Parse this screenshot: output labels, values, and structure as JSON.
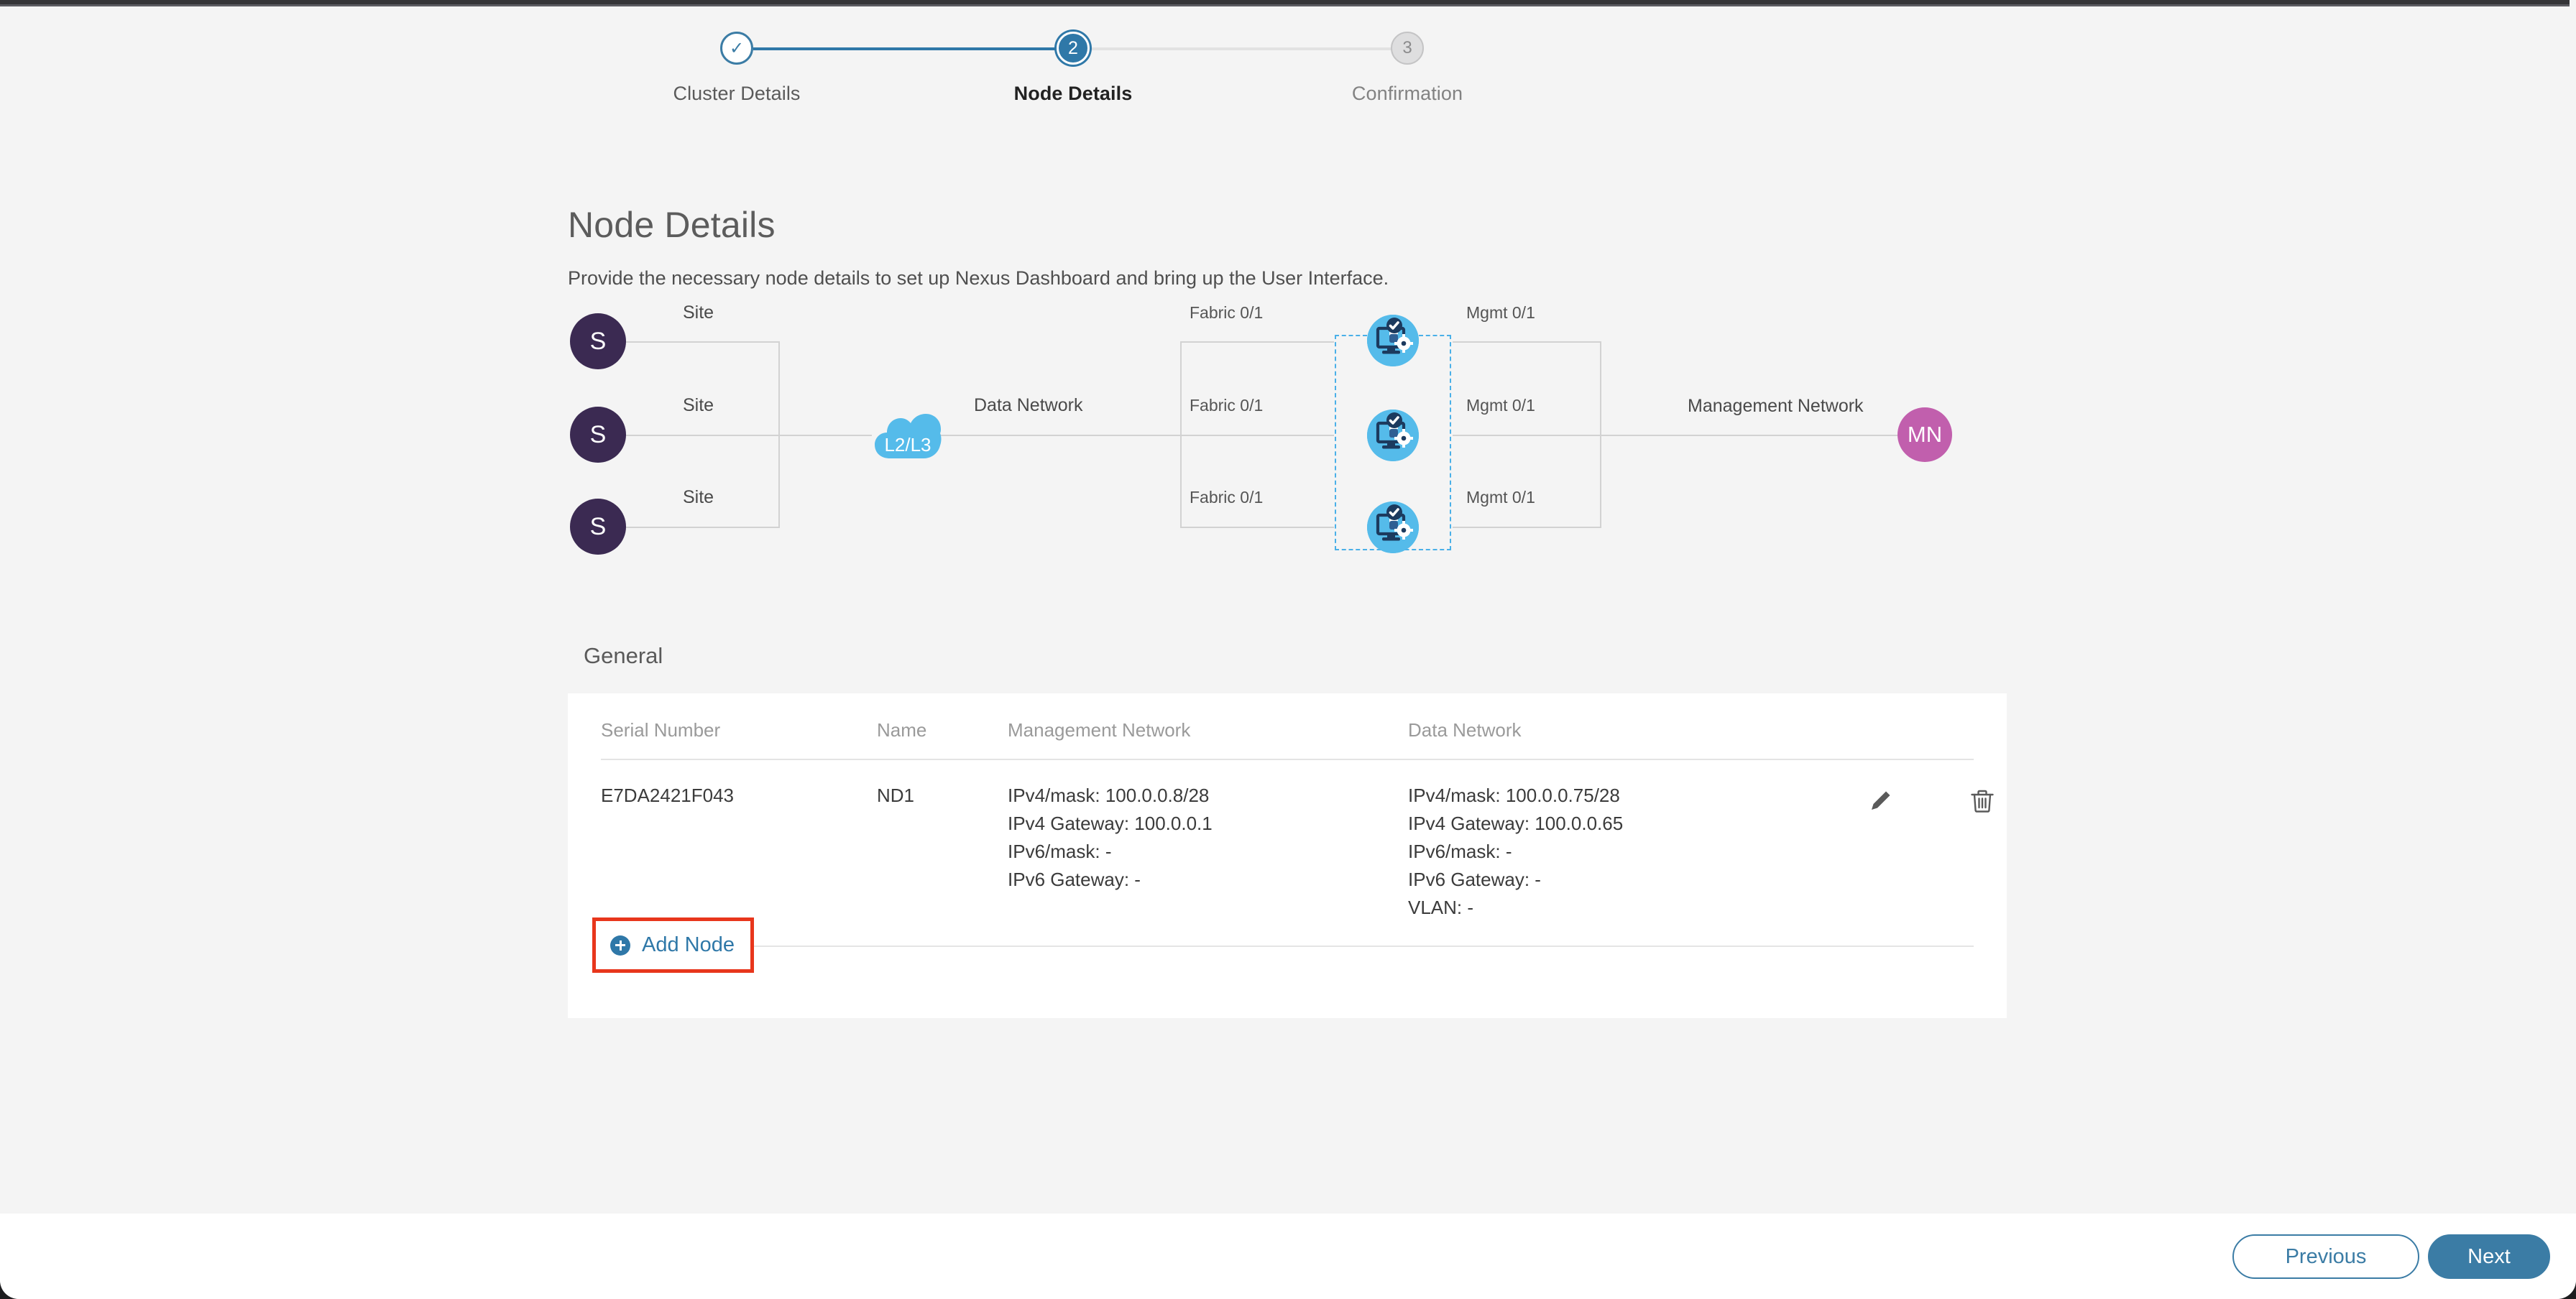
{
  "window": {
    "accent_color": "#2f78a8",
    "highlight_color": "#e8361c"
  },
  "stepper": {
    "steps": [
      {
        "id": "cluster-details",
        "marker": "✓",
        "label": "Cluster Details",
        "state": "done"
      },
      {
        "id": "node-details",
        "marker": "2",
        "label": "Node Details",
        "state": "current"
      },
      {
        "id": "confirmation",
        "marker": "3",
        "label": "Confirmation",
        "state": "todo"
      }
    ]
  },
  "page": {
    "title": "Node Details",
    "subtitle": "Provide the necessary node details to set up Nexus Dashboard and bring up the User Interface."
  },
  "topology": {
    "sites": [
      {
        "initial": "S",
        "label": "Site"
      },
      {
        "initial": "S",
        "label": "Site"
      },
      {
        "initial": "S",
        "label": "Site"
      }
    ],
    "cloud_label": "L2/L3",
    "data_network_label": "Data Network",
    "fabric_labels": [
      "Fabric 0/1",
      "Fabric 0/1",
      "Fabric 0/1"
    ],
    "mgmt_labels": [
      "Mgmt 0/1",
      "Mgmt 0/1",
      "Mgmt 0/1"
    ],
    "management_network_label": "Management Network",
    "mn_initials": "MN",
    "node_icon_name": "nexus-dashboard-node-icon"
  },
  "general": {
    "section_title": "General",
    "columns": [
      "Serial Number",
      "Name",
      "Management Network",
      "Data Network"
    ],
    "rows": [
      {
        "serial": "E7DA2421F043",
        "name": "ND1",
        "mgmt": [
          "IPv4/mask: 100.0.0.8/28",
          "IPv4 Gateway: 100.0.0.1",
          "IPv6/mask: -",
          "IPv6 Gateway: -"
        ],
        "data": [
          "IPv4/mask: 100.0.0.75/28",
          "IPv4 Gateway: 100.0.0.65",
          "IPv6/mask: -",
          "IPv6 Gateway: -",
          "VLAN: -"
        ]
      }
    ],
    "add_node_label": "Add Node"
  },
  "footer": {
    "previous_label": "Previous",
    "next_label": "Next"
  }
}
